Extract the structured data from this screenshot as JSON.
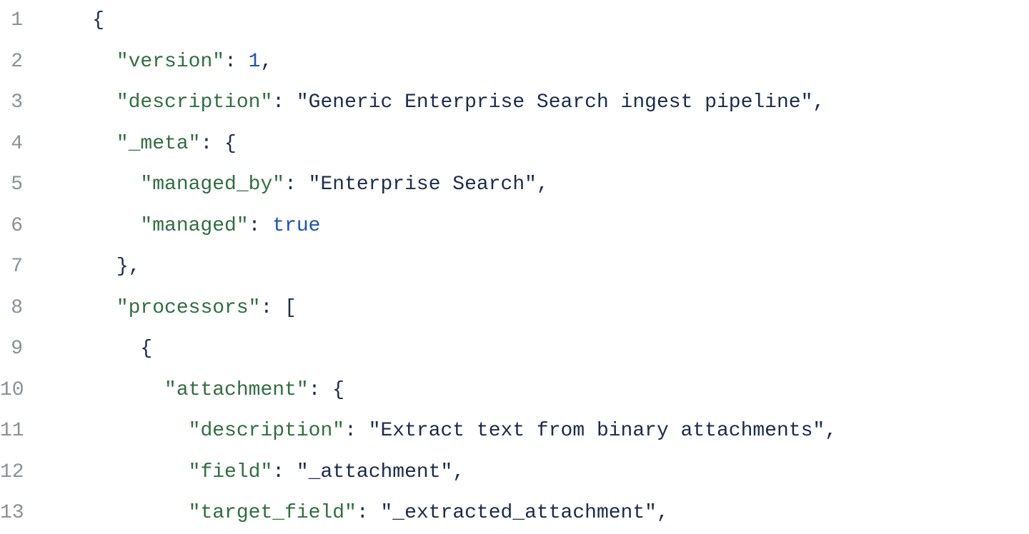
{
  "colors": {
    "gutter": "#8a8f98",
    "punc": "#1a2b4c",
    "key": "#2f6f3f",
    "string": "#1a2b4c",
    "number": "#1a4fc4",
    "bool": "#1a4fc4",
    "bg": "#ffffff"
  },
  "lines": [
    {
      "n": "1",
      "indent": 2,
      "tokens": [
        {
          "t": "punc",
          "v": "{"
        }
      ]
    },
    {
      "n": "2",
      "indent": 3,
      "tokens": [
        {
          "t": "key",
          "v": "\"version\""
        },
        {
          "t": "punc",
          "v": ": "
        },
        {
          "t": "number",
          "v": "1"
        },
        {
          "t": "punc",
          "v": ","
        }
      ]
    },
    {
      "n": "3",
      "indent": 3,
      "tokens": [
        {
          "t": "key",
          "v": "\"description\""
        },
        {
          "t": "punc",
          "v": ": "
        },
        {
          "t": "string",
          "v": "\"Generic Enterprise Search ingest pipeline\""
        },
        {
          "t": "punc",
          "v": ","
        }
      ]
    },
    {
      "n": "4",
      "indent": 3,
      "tokens": [
        {
          "t": "key",
          "v": "\"_meta\""
        },
        {
          "t": "punc",
          "v": ": {"
        }
      ]
    },
    {
      "n": "5",
      "indent": 4,
      "tokens": [
        {
          "t": "key",
          "v": "\"managed_by\""
        },
        {
          "t": "punc",
          "v": ": "
        },
        {
          "t": "string",
          "v": "\"Enterprise Search\""
        },
        {
          "t": "punc",
          "v": ","
        }
      ]
    },
    {
      "n": "6",
      "indent": 4,
      "tokens": [
        {
          "t": "key",
          "v": "\"managed\""
        },
        {
          "t": "punc",
          "v": ": "
        },
        {
          "t": "bool",
          "v": "true"
        }
      ]
    },
    {
      "n": "7",
      "indent": 3,
      "tokens": [
        {
          "t": "punc",
          "v": "},"
        }
      ]
    },
    {
      "n": "8",
      "indent": 3,
      "tokens": [
        {
          "t": "key",
          "v": "\"processors\""
        },
        {
          "t": "punc",
          "v": ": ["
        }
      ]
    },
    {
      "n": "9",
      "indent": 4,
      "tokens": [
        {
          "t": "punc",
          "v": "{"
        }
      ]
    },
    {
      "n": "10",
      "indent": 5,
      "tokens": [
        {
          "t": "key",
          "v": "\"attachment\""
        },
        {
          "t": "punc",
          "v": ": {"
        }
      ]
    },
    {
      "n": "11",
      "indent": 6,
      "tokens": [
        {
          "t": "key",
          "v": "\"description\""
        },
        {
          "t": "punc",
          "v": ": "
        },
        {
          "t": "string",
          "v": "\"Extract text from binary attachments\""
        },
        {
          "t": "punc",
          "v": ","
        }
      ]
    },
    {
      "n": "12",
      "indent": 6,
      "tokens": [
        {
          "t": "key",
          "v": "\"field\""
        },
        {
          "t": "punc",
          "v": ": "
        },
        {
          "t": "string",
          "v": "\"_attachment\""
        },
        {
          "t": "punc",
          "v": ","
        }
      ]
    },
    {
      "n": "13",
      "indent": 6,
      "tokens": [
        {
          "t": "key",
          "v": "\"target_field\""
        },
        {
          "t": "punc",
          "v": ": "
        },
        {
          "t": "string",
          "v": "\"_extracted_attachment\""
        },
        {
          "t": "punc",
          "v": ","
        }
      ]
    }
  ],
  "represented_json": {
    "version": 1,
    "description": "Generic Enterprise Search ingest pipeline",
    "_meta": {
      "managed_by": "Enterprise Search",
      "managed": true
    },
    "processors": [
      {
        "attachment": {
          "description": "Extract text from binary attachments",
          "field": "_attachment",
          "target_field": "_extracted_attachment"
        }
      }
    ]
  }
}
